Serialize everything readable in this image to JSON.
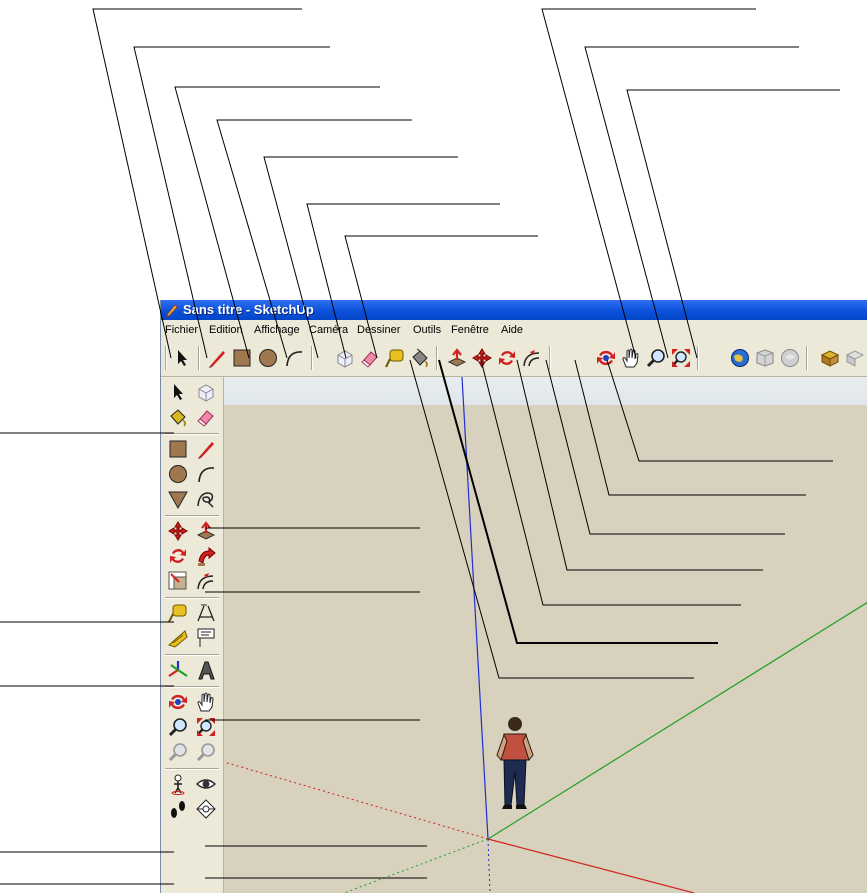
{
  "window": {
    "title": "Sans titre - SketchUp"
  },
  "menu": [
    "Fichier",
    "Edition",
    "Affichage",
    "Caméra",
    "Dessiner",
    "Outils",
    "Fenêtre",
    "Aide"
  ],
  "colors": {
    "title_bar": "#0a4fd8",
    "chrome": "#ece9d8",
    "ground": "#d7d1be",
    "sky": "#e4eaee",
    "axis_red": "#d02020",
    "axis_green": "#20a020",
    "axis_blue": "#2030d0"
  },
  "top_toolbar": [
    "select-arrow-icon",
    "pencil-line-icon",
    "rectangle-icon",
    "circle-icon",
    "arc-icon",
    "make-component-icon",
    "eraser-icon",
    "tape-measure-icon",
    "paint-bucket-icon",
    "push-pull-icon",
    "move-icon",
    "rotate-icon",
    "offset-icon",
    "orbit-icon",
    "pan-hand-icon",
    "zoom-icon",
    "zoom-extents-icon",
    "google-earth-icon",
    "get-models-icon",
    "share-model-icon",
    "components-icon"
  ],
  "left_toolbar": [
    "select-arrow-icon",
    "make-component-icon",
    "paint-bucket-icon",
    "eraser-icon",
    "rectangle-icon",
    "pencil-line-icon",
    "circle-icon",
    "arc-icon",
    "polygon-icon",
    "freehand-icon",
    "move-icon",
    "push-pull-icon",
    "rotate-icon",
    "follow-me-icon",
    "scale-icon",
    "offset-icon",
    "tape-measure-icon",
    "dimensions-icon",
    "protractor-icon",
    "text-label-icon",
    "axes-icon",
    "3d-text-icon",
    "orbit-icon",
    "pan-hand-icon",
    "zoom-icon",
    "zoom-extents-icon",
    "previous-view-icon",
    "next-view-icon",
    "position-camera-icon",
    "look-around-icon",
    "walk-icon",
    "section-plane-icon"
  ]
}
